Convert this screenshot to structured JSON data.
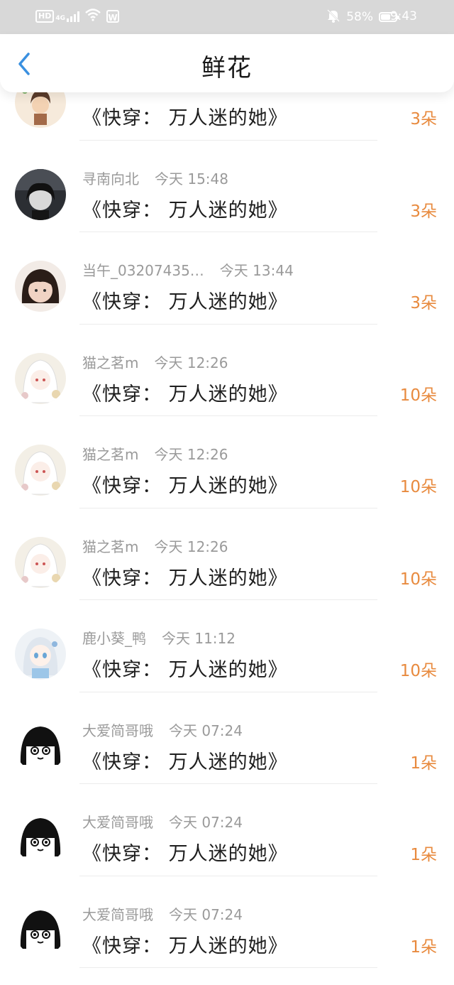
{
  "status_bar": {
    "hd": "HD",
    "network": "4G",
    "battery_pct": "58%",
    "battery_level": 0.58,
    "time": "9:43"
  },
  "nav": {
    "title": "鲜花",
    "back_icon": "chevron-left-icon",
    "accent": "#3a90e0"
  },
  "items": [
    {
      "name": "",
      "time": "",
      "book": "《快穿： 万人迷的她》",
      "amount": "3朵",
      "avatar": "avatar-illustration-boy"
    },
    {
      "name": "寻南向北",
      "time": "今天 15:48",
      "book": "《快穿： 万人迷的她》",
      "amount": "3朵",
      "avatar": "avatar-dark-photo"
    },
    {
      "name": "当午_03207435…",
      "time": "今天 13:44",
      "book": "《快穿： 万人迷的她》",
      "amount": "3朵",
      "avatar": "avatar-girl-photo"
    },
    {
      "name": "猫之茗m",
      "time": "今天 12:26",
      "book": "《快穿： 万人迷的她》",
      "amount": "10朵",
      "avatar": "avatar-white-hair"
    },
    {
      "name": "猫之茗m",
      "time": "今天 12:26",
      "book": "《快穿： 万人迷的她》",
      "amount": "10朵",
      "avatar": "avatar-white-hair"
    },
    {
      "name": "猫之茗m",
      "time": "今天 12:26",
      "book": "《快穿： 万人迷的她》",
      "amount": "10朵",
      "avatar": "avatar-white-hair"
    },
    {
      "name": "鹿小葵_鸭",
      "time": "今天 11:12",
      "book": "《快穿： 万人迷的她》",
      "amount": "10朵",
      "avatar": "avatar-anime-girl"
    },
    {
      "name": "大爱简哥哦",
      "time": "今天 07:24",
      "book": "《快穿： 万人迷的她》",
      "amount": "1朵",
      "avatar": "avatar-manga-girl"
    },
    {
      "name": "大爱简哥哦",
      "time": "今天 07:24",
      "book": "《快穿： 万人迷的她》",
      "amount": "1朵",
      "avatar": "avatar-manga-girl"
    },
    {
      "name": "大爱简哥哦",
      "time": "今天 07:24",
      "book": "《快穿： 万人迷的她》",
      "amount": "1朵",
      "avatar": "avatar-manga-girl"
    }
  ]
}
